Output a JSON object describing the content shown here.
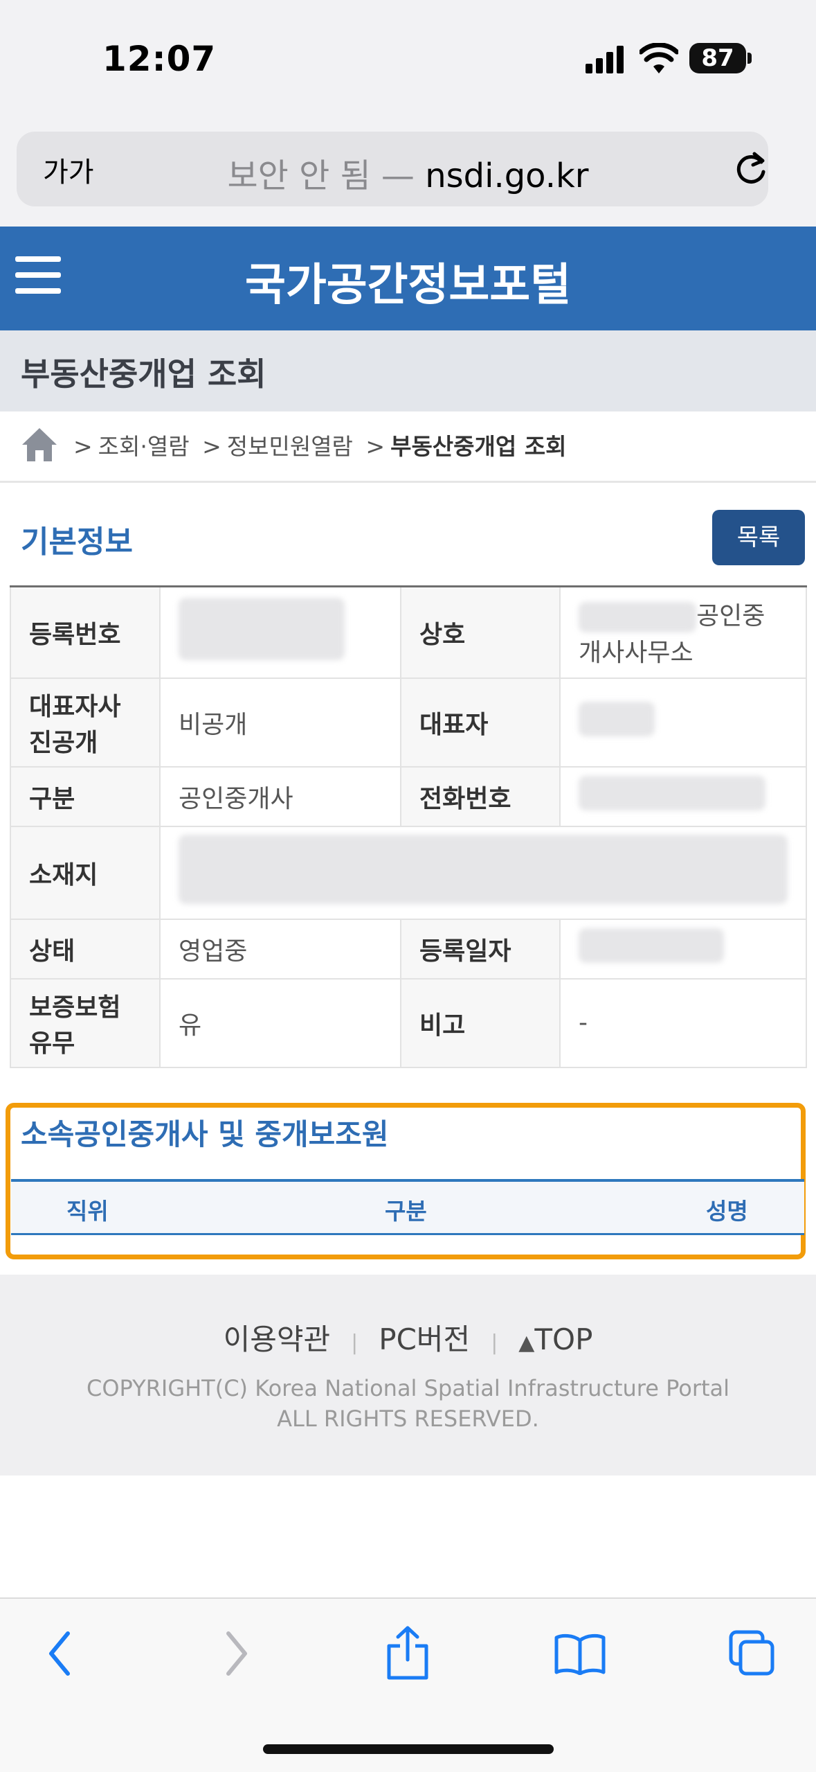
{
  "status_bar": {
    "time": "12:07",
    "battery": "87"
  },
  "browser": {
    "text_size_button": "가가",
    "url_insecure_label": "보안 안 됨 —",
    "url_host": "nsdi.go.kr"
  },
  "site": {
    "title": "국가공간정보포털"
  },
  "page": {
    "title": "부동산중개업 조회"
  },
  "breadcrumb": {
    "items": [
      "조회·열람",
      "정보민원열람",
      "부동산중개업 조회"
    ]
  },
  "basic_info": {
    "title": "기본정보",
    "list_button": "목록",
    "labels": {
      "reg_no": "등록번호",
      "trade_name": "상호",
      "photo_public": "대표자사진공개",
      "representative": "대표자",
      "category": "구분",
      "phone": "전화번호",
      "address": "소재지",
      "state": "상태",
      "reg_date": "등록일자",
      "insurance": "보증보험유무",
      "remarks": "비고"
    },
    "values": {
      "trade_name_suffix": "공인중개사사무소",
      "photo_public": "비공개",
      "category": "공인중개사",
      "state": "영업중",
      "insurance": "유",
      "remarks": "-"
    }
  },
  "staff_section": {
    "title": "소속공인중개사 및 중개보조원",
    "columns": [
      "직위",
      "구분",
      "성명"
    ]
  },
  "footer": {
    "terms": "이용약관",
    "pc_version": "PC버전",
    "top": "TOP",
    "copyright_line1": "COPYRIGHT(C) Korea National Spatial Infrastructure Portal",
    "copyright_line2": "ALL RIGHTS RESERVED."
  }
}
